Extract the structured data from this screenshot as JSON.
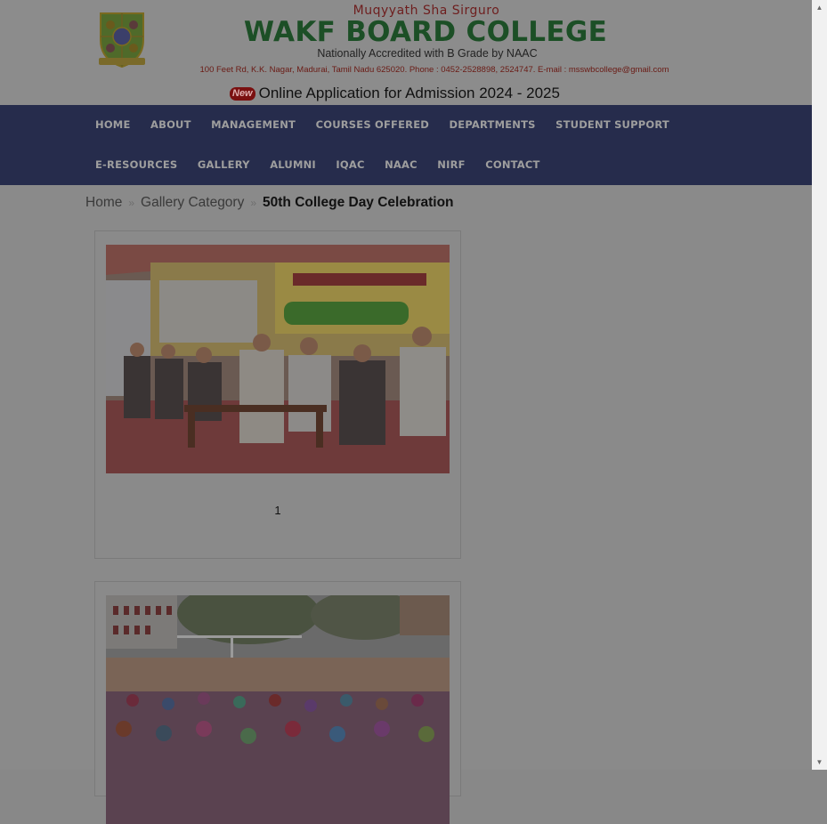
{
  "header": {
    "tagline": "Muqyyath  Sha  Sirguro",
    "college_name": "WAKF BOARD COLLEGE",
    "accreditation": "Nationally Accredited with B Grade by NAAC",
    "address": "100 Feet Rd, K.K. Nagar, Madurai, Tamil Nadu 625020. Phone : 0452-2528898, 2524747.  E-mail : msswbcollege@gmail.com",
    "new_badge": "New",
    "admission_text": "Online Application for Admission 2024 - 2025"
  },
  "nav": {
    "row1": [
      "HOME",
      "ABOUT",
      "MANAGEMENT",
      "COURSES OFFERED",
      "DEPARTMENTS",
      "STUDENT SUPPORT"
    ],
    "row2": [
      "E-RESOURCES",
      "GALLERY",
      "ALUMNI",
      "IQAC",
      "NAAC",
      "NIRF",
      "CONTACT"
    ]
  },
  "breadcrumb": {
    "home": "Home",
    "category": "Gallery Category",
    "current": "50th College Day Celebration",
    "separator": "»"
  },
  "gallery": [
    {
      "caption": "1"
    },
    {
      "caption": ""
    }
  ],
  "colors": {
    "nav_bg": "#262c4c",
    "college_name": "#1c4f26",
    "overlay_page": "#8a8a8a"
  }
}
